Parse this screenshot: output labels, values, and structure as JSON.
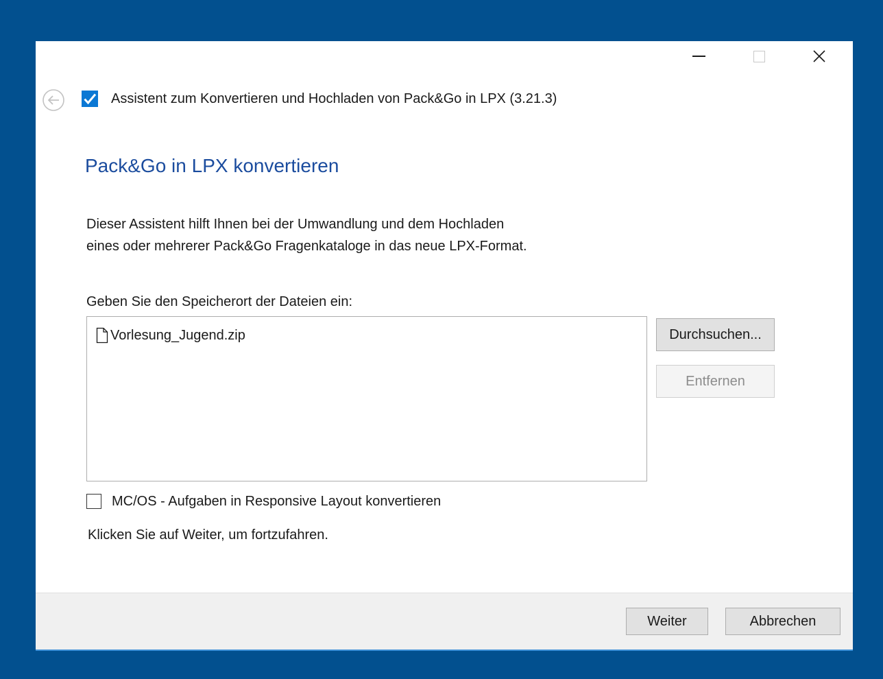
{
  "window": {
    "controls": {
      "minimize_icon": "minimize-icon",
      "maximize_icon": "maximize-icon",
      "close_icon": "close-icon"
    }
  },
  "header": {
    "back_icon": "back-arrow-icon",
    "app_icon": "checkmark-icon",
    "title": "Assistent zum Konvertieren und Hochladen von Pack&Go in LPX (3.21.3)"
  },
  "main": {
    "heading": "Pack&Go in LPX konvertieren",
    "intro_lines": [
      "Dieser Assistent hilft Ihnen bei der Umwandlung und dem Hochladen",
      "eines oder mehrerer Pack&Go Fragenkataloge in das neue LPX-Format."
    ],
    "location_label": "Geben Sie den Speicherort der Dateien ein:",
    "files": [
      {
        "icon": "file-icon",
        "name": "Vorlesung_Jugend.zip"
      }
    ],
    "browse_label": "Durchsuchen...",
    "remove_label": "Entfernen",
    "remove_enabled": false,
    "checkbox_label": "MC/OS - Aufgaben in Responsive Layout konvertieren",
    "checkbox_checked": false,
    "continue_hint": "Klicken Sie auf Weiter, um fortzufahren."
  },
  "footer": {
    "next_label": "Weiter",
    "cancel_label": "Abbrechen"
  },
  "colors": {
    "desktop_background": "#02508F",
    "heading": "#1b4c9e",
    "checkmark_icon_bg": "#0b78d4",
    "footer_background": "#f0f0f0",
    "disabled_text": "#8c8c8c"
  }
}
